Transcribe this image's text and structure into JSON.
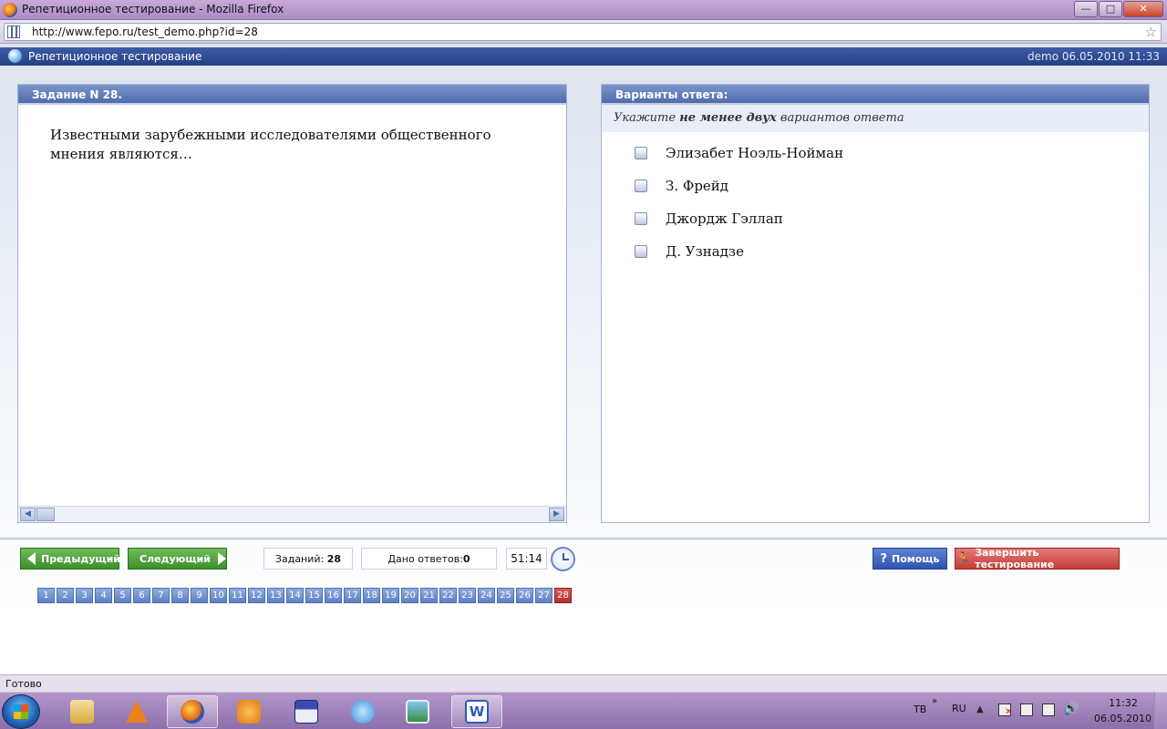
{
  "window": {
    "title": "Репетиционное тестирование - Mozilla Firefox",
    "minimize_label": "—",
    "maximize_label": "□",
    "close_label": "✕"
  },
  "addressbar": {
    "url": "http://www.fepo.ru/test_demo.php?id=28"
  },
  "app": {
    "title": "Репетиционное тестирование",
    "user_info": "demo 06.05.2010 11:33"
  },
  "question": {
    "header": "Задание N 28.",
    "text": "Известными зарубежными исследователями общественного мнения являются…"
  },
  "answers": {
    "header": "Варианты ответа:",
    "instruction_prefix": "Укажите ",
    "instruction_bold": "не менее двух",
    "instruction_suffix": " вариантов ответа",
    "options": [
      {
        "label": "Элизабет Ноэль-Нойман",
        "checked": false
      },
      {
        "label": "З. Фрейд",
        "checked": false
      },
      {
        "label": "Джордж Гэллап",
        "checked": false
      },
      {
        "label": "Д. Узнадзе",
        "checked": false
      }
    ]
  },
  "toolbar": {
    "prev_label": "Предыдущий",
    "next_label": "Следующий",
    "tasks_label": "Заданий:",
    "tasks_count": "28",
    "answers_label": "Дано ответов:",
    "answers_count": "0",
    "timer": "51:14",
    "help_label": "Помощь",
    "finish_label": "Завершить тестирование"
  },
  "pager": {
    "pages": [
      "1",
      "2",
      "3",
      "4",
      "5",
      "6",
      "7",
      "8",
      "9",
      "10",
      "11",
      "12",
      "13",
      "14",
      "15",
      "16",
      "17",
      "18",
      "19",
      "20",
      "21",
      "22",
      "23",
      "24",
      "25",
      "26",
      "27",
      "28"
    ],
    "current": "28"
  },
  "statusbar": {
    "text": "Готово"
  },
  "tray": {
    "lang1": "ТВ",
    "arrows": "»",
    "lang2": "RU",
    "time": "11:32",
    "date": "06.05.2010"
  },
  "colors": {
    "header_blue": "#3d5ca6",
    "green_button": "#4ea23b",
    "red_button": "#c8433e",
    "current_page": "#c4403a"
  }
}
